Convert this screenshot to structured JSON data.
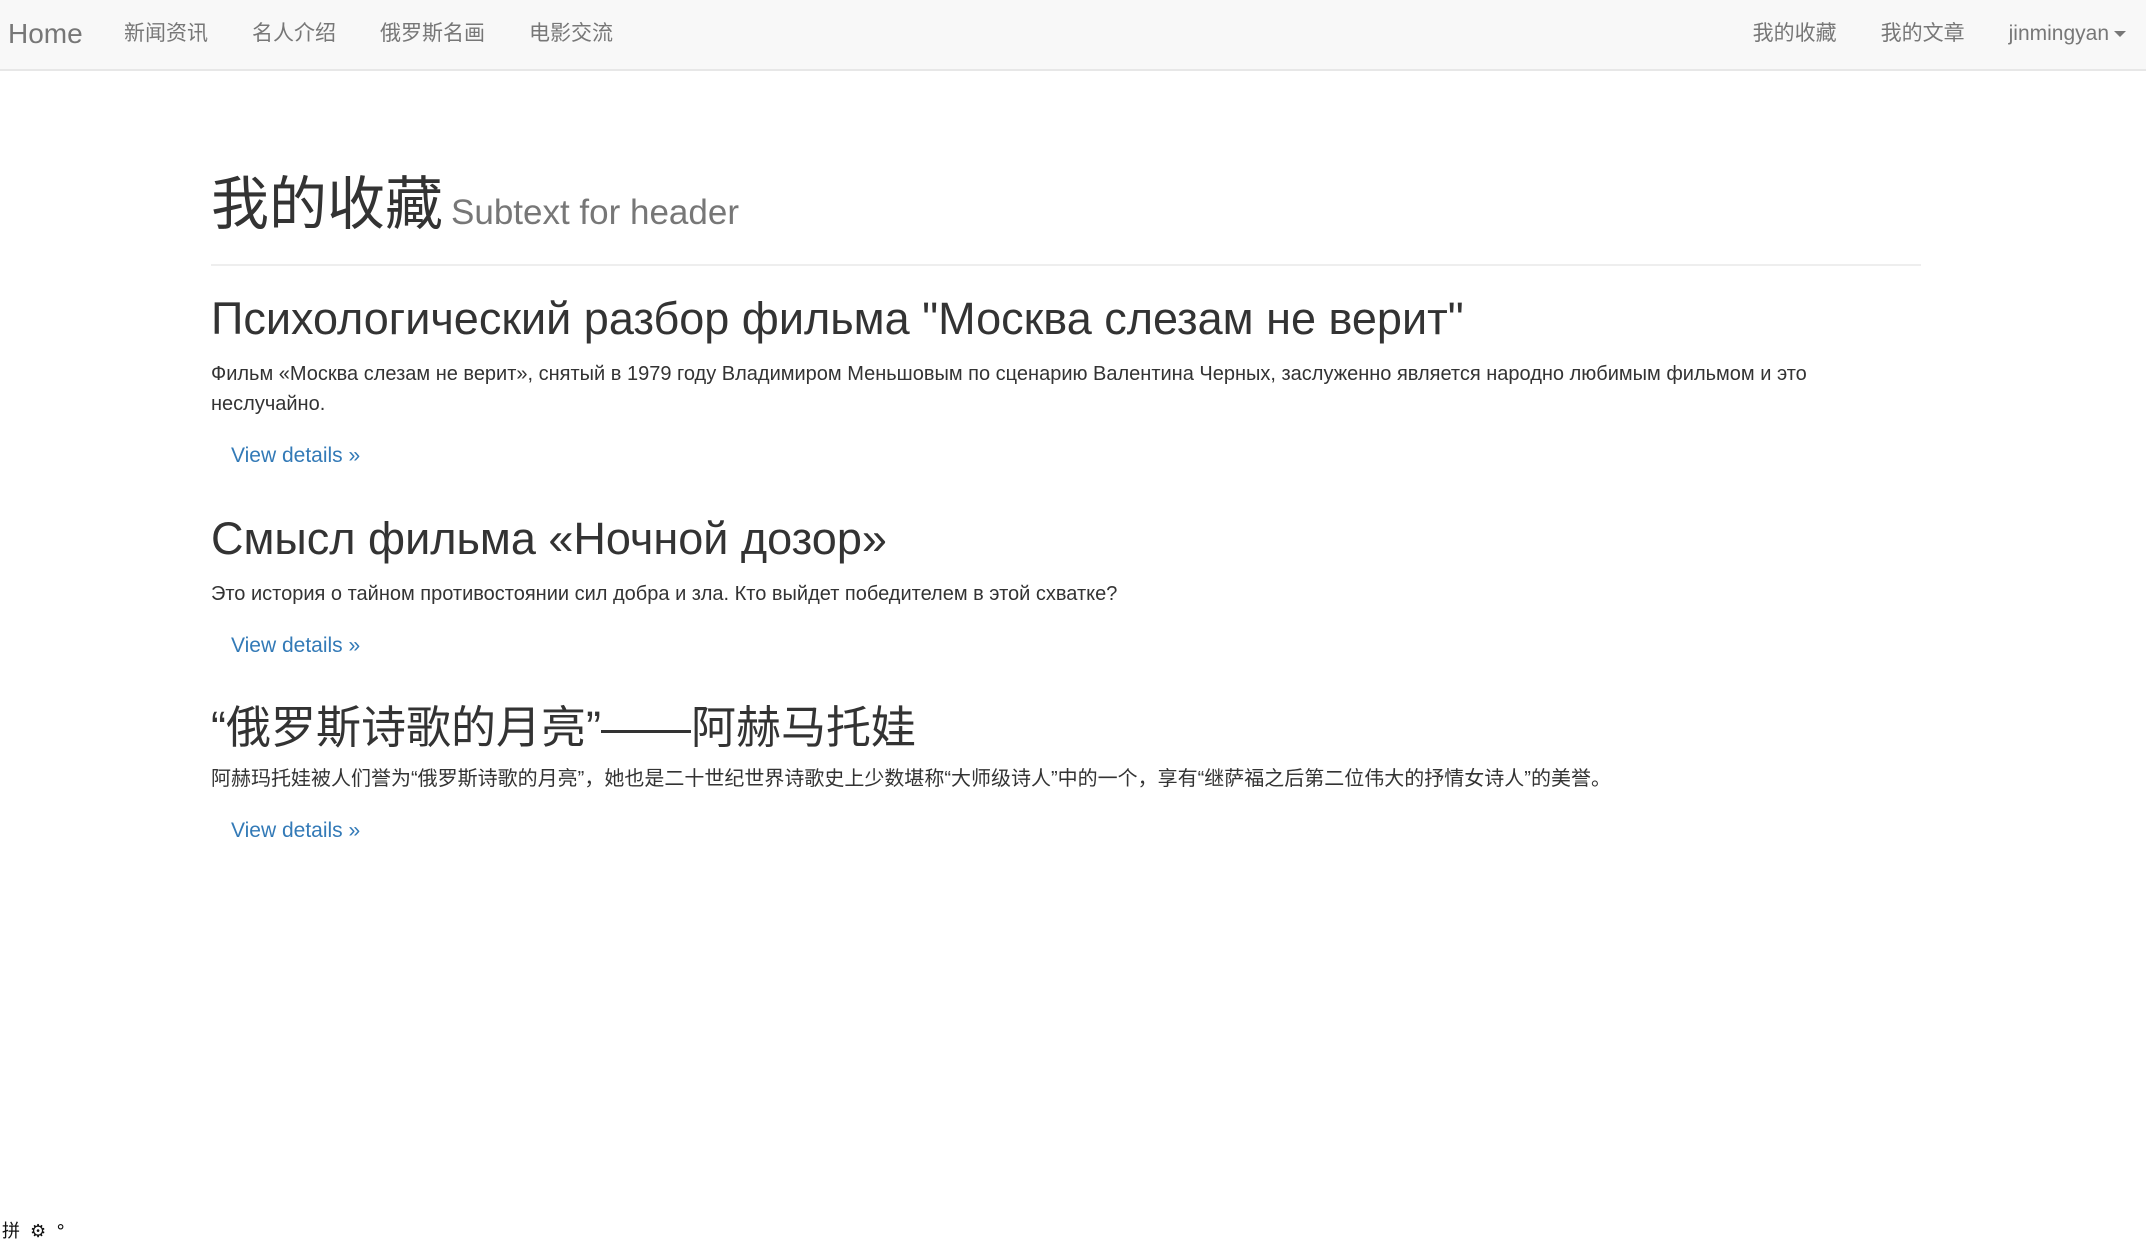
{
  "navbar": {
    "brand": "Home",
    "left_items": [
      "新闻资讯",
      "名人介绍",
      "俄罗斯名画",
      "电影交流"
    ],
    "right_items": [
      "我的收藏",
      "我的文章"
    ],
    "user": "jinmingyan"
  },
  "header": {
    "title": "我的收藏",
    "subtitle": "Subtext for header"
  },
  "articles": [
    {
      "title": "Психологический разбор фильма \"Москва слезам не верит\"",
      "summary": "Фильм «Москва слезам не верит», снятый в 1979 году Владимиром Меньшовым по сценарию Валентина Черных, заслуженно является народно любимым фильмом и это неслучайно.",
      "link": "View details »"
    },
    {
      "title": "Смысл фильма «Ночной дозор»",
      "summary": "Это история о тайном противостоянии сил добра и зла. Кто выйдет победителем в этой схватке?",
      "link": "View details »"
    },
    {
      "title": "“俄罗斯诗歌的月亮”——阿赫马托娃",
      "summary": "阿赫玛托娃被人们誉为“俄罗斯诗歌的月亮”，她也是二十世纪世界诗歌史上少数堪称“大师级诗人”中的一个，享有“继萨福之后第二位伟大的抒情女诗人”的美誉。",
      "link": "View details »"
    }
  ],
  "tray": {
    "glyph_1": "拼",
    "glyph_2": "⚙",
    "glyph_3": "°"
  }
}
